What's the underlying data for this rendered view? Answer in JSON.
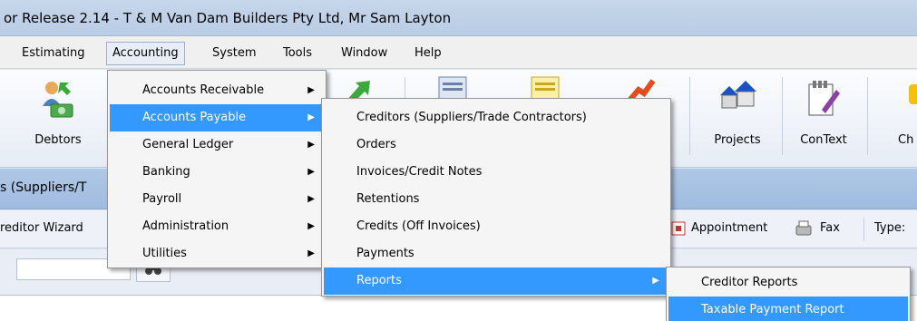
{
  "window": {
    "title": "or Release 2.14 - T & M Van Dam Builders Pty Ltd, Mr Sam Layton"
  },
  "menubar": {
    "items": [
      {
        "label": "Estimating",
        "active": false
      },
      {
        "label": "Accounting",
        "active": true
      },
      {
        "label": "System",
        "active": false
      },
      {
        "label": "Tools",
        "active": false
      },
      {
        "label": "Window",
        "active": false
      },
      {
        "label": "Help",
        "active": false
      }
    ]
  },
  "toolbar": {
    "buttons": [
      {
        "label": "Debtors",
        "icon": "debtors-icon"
      },
      {
        "label": "Projects",
        "icon": "projects-icon"
      },
      {
        "label": "ConText",
        "icon": "context-icon"
      },
      {
        "label": "Ch",
        "icon": "ch-icon"
      }
    ]
  },
  "inner_window": {
    "title": "s (Suppliers/T",
    "subtoolbar": {
      "wizard_label": "reditor Wizard",
      "appointment_label": "Appointment",
      "fax_label": "Fax",
      "type_label": "Type:"
    }
  },
  "accounting_menu": {
    "items": [
      {
        "label": "Accounts Receivable",
        "has_submenu": true,
        "highlighted": false
      },
      {
        "label": "Accounts Payable",
        "has_submenu": true,
        "highlighted": true
      },
      {
        "label": "General Ledger",
        "has_submenu": true,
        "highlighted": false
      },
      {
        "label": "Banking",
        "has_submenu": true,
        "highlighted": false
      },
      {
        "label": "Payroll",
        "has_submenu": true,
        "highlighted": false
      },
      {
        "label": "Administration",
        "has_submenu": true,
        "highlighted": false
      },
      {
        "label": "Utilities",
        "has_submenu": true,
        "highlighted": false
      }
    ]
  },
  "accounts_payable_menu": {
    "items": [
      {
        "label": "Creditors (Suppliers/Trade Contractors)",
        "has_submenu": false,
        "highlighted": false
      },
      {
        "label": "Orders",
        "has_submenu": false,
        "highlighted": false
      },
      {
        "label": "Invoices/Credit Notes",
        "has_submenu": false,
        "highlighted": false
      },
      {
        "label": "Retentions",
        "has_submenu": false,
        "highlighted": false
      },
      {
        "label": "Credits (Off Invoices)",
        "has_submenu": false,
        "highlighted": false
      },
      {
        "label": "Payments",
        "has_submenu": false,
        "highlighted": false
      },
      {
        "label": "Reports",
        "has_submenu": true,
        "highlighted": true
      }
    ]
  },
  "reports_menu": {
    "items": [
      {
        "label": "Creditor Reports",
        "highlighted": false
      },
      {
        "label": "Taxable Payment Report",
        "highlighted": true
      }
    ]
  },
  "colors": {
    "highlight": "#3399ff",
    "menu_bg": "#f5f5f5",
    "titlebar": "#c6d6ea"
  }
}
